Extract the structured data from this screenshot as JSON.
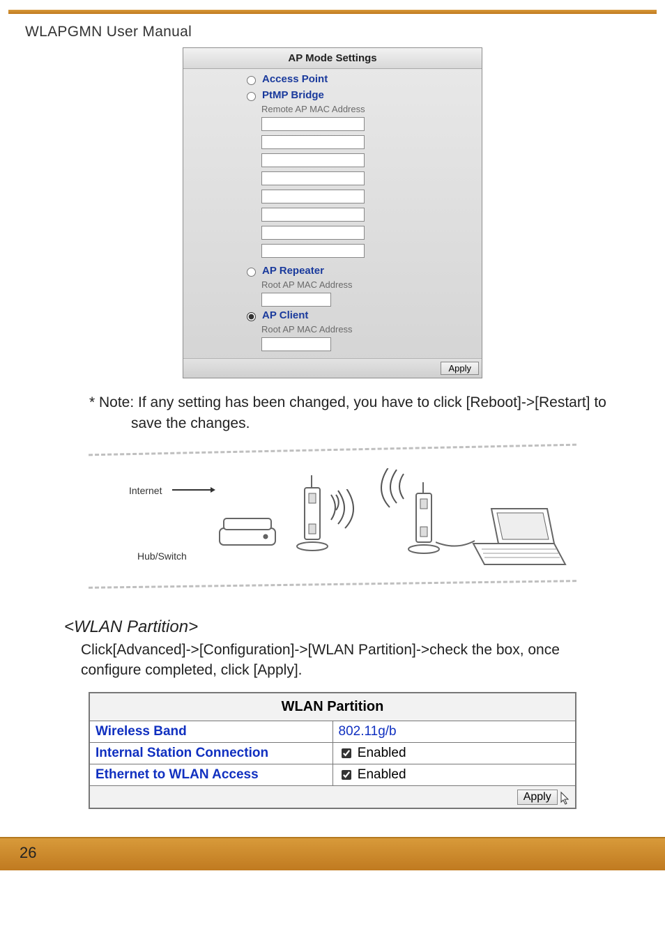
{
  "header": {
    "title": "WLAPGMN User Manual"
  },
  "ap_panel": {
    "title": "AP Mode Settings",
    "options": {
      "access_point": "Access Point",
      "ptmp_bridge": "PtMP Bridge",
      "ap_repeater": "AP Repeater",
      "ap_client": "AP Client"
    },
    "remote_mac_label": "Remote AP MAC Address",
    "root_mac_label": "Root AP MAC Address",
    "apply_label": "Apply"
  },
  "note_text": "* Note: If any setting has been changed, you have to click [Reboot]->[Restart] to save the changes.",
  "diagram": {
    "internet_label": "Internet",
    "hub_label": "Hub/Switch"
  },
  "wlan_section": {
    "heading": "<WLAN Partition>",
    "body": "Click[Advanced]->[Configuration]->[WLAN Partition]->check the box, once configure completed, click [Apply]."
  },
  "wlan_table": {
    "title": "WLAN Partition",
    "rows": [
      {
        "key": "Wireless Band",
        "value": "802.11g/b",
        "checkbox": false
      },
      {
        "key": "Internal Station Connection",
        "value": "Enabled",
        "checkbox": true,
        "checked": true
      },
      {
        "key": "Ethernet to WLAN Access",
        "value": "Enabled",
        "checkbox": true,
        "checked": true
      }
    ],
    "apply_label": "Apply"
  },
  "page_number": "26"
}
